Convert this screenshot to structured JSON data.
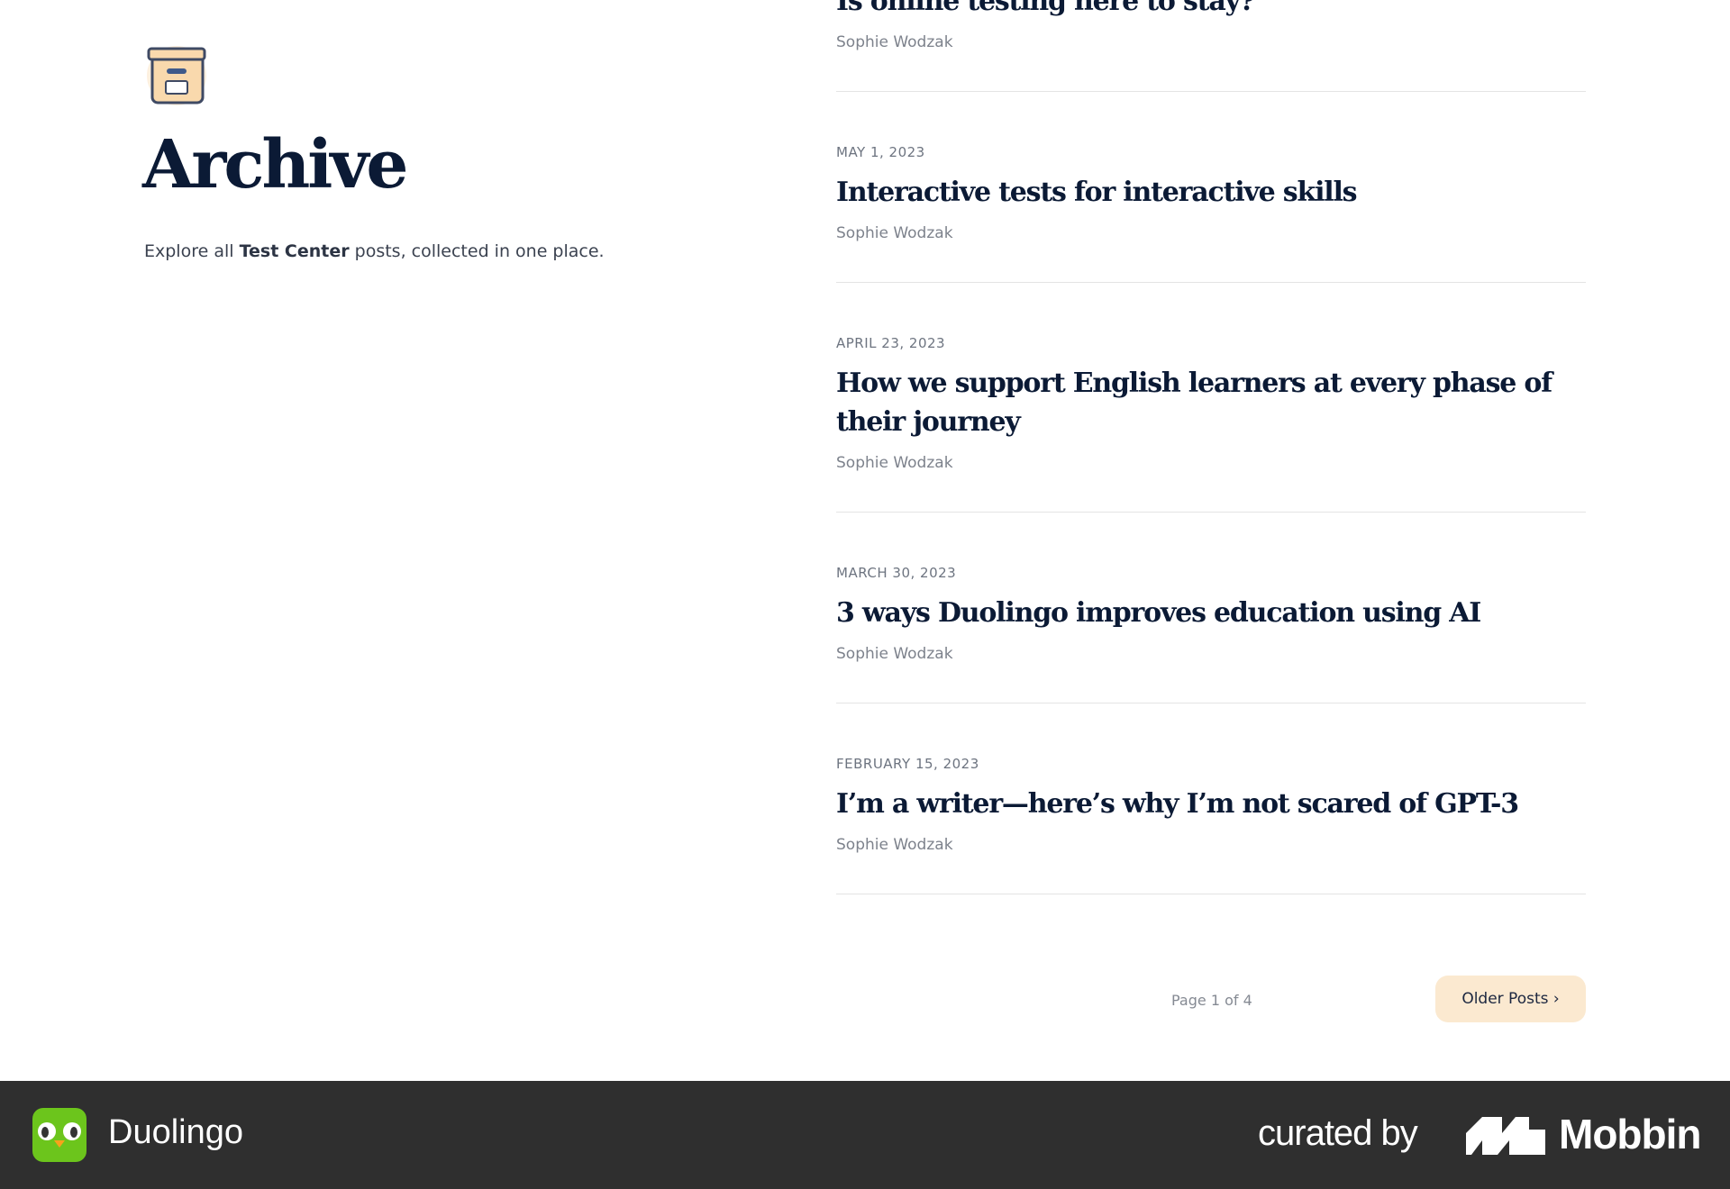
{
  "header": {
    "title": "Archive",
    "desc_pre": "Explore all ",
    "desc_bold": "Test Center",
    "desc_post": " posts, collected in one place."
  },
  "posts": [
    {
      "date": "",
      "title": "Is online testing here to stay?",
      "author": "Sophie Wodzak"
    },
    {
      "date": "MAY 1, 2023",
      "title": "Interactive tests for interactive skills",
      "author": "Sophie Wodzak"
    },
    {
      "date": "APRIL 23, 2023",
      "title": "How we support English learners at every phase of their journey",
      "author": "Sophie Wodzak"
    },
    {
      "date": "MARCH 30, 2023",
      "title": "3 ways Duolingo improves education using AI",
      "author": "Sophie Wodzak"
    },
    {
      "date": "FEBRUARY 15, 2023",
      "title": "I’m a writer—here’s why I’m not scared of GPT-3",
      "author": "Sophie Wodzak"
    }
  ],
  "pagination": {
    "label": "Page 1 of 4",
    "older": "Older Posts ›"
  },
  "footer": {
    "app": "Duolingo",
    "curated": "curated by",
    "brand": "Mobbin"
  },
  "colors": {
    "accent": "#fbe9d0",
    "footer_bg": "#2f2f2f",
    "duo_green": "#6cc51c"
  }
}
